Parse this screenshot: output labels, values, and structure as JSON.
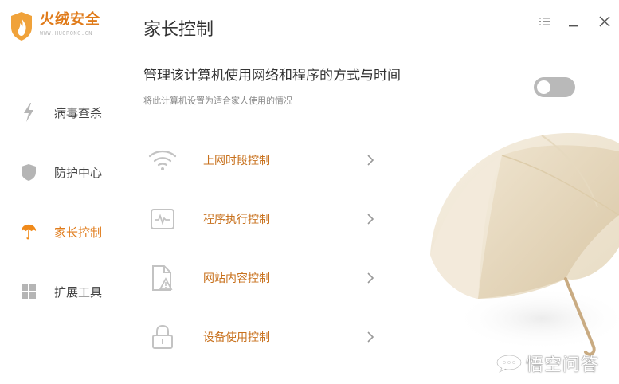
{
  "app": {
    "logo_title": "火绒安全",
    "logo_subtitle": "WWW.HUORONG.CN",
    "brand_color": "#e07b1a"
  },
  "sidebar": {
    "items": [
      {
        "label": "病毒查杀",
        "icon": "lightning-icon",
        "active": false
      },
      {
        "label": "防护中心",
        "icon": "shield-icon",
        "active": false
      },
      {
        "label": "家长控制",
        "icon": "umbrella-icon",
        "active": true
      },
      {
        "label": "扩展工具",
        "icon": "grid-icon",
        "active": false
      }
    ]
  },
  "header": {
    "title": "家长控制",
    "window_controls": [
      "menu-icon",
      "minimize-icon",
      "close-icon"
    ]
  },
  "main": {
    "heading": "管理该计算机使用网络和程序的方式与时间",
    "subheading": "将此计算机设置为适合家人使用的情况",
    "toggle_on": false,
    "items": [
      {
        "label": "上网时段控制",
        "icon": "wifi-icon"
      },
      {
        "label": "程序执行控制",
        "icon": "pulse-monitor-icon"
      },
      {
        "label": "网站内容控制",
        "icon": "document-warning-icon"
      },
      {
        "label": "设备使用控制",
        "icon": "lock-icon"
      }
    ]
  },
  "watermark": {
    "text": "悟空问答"
  }
}
